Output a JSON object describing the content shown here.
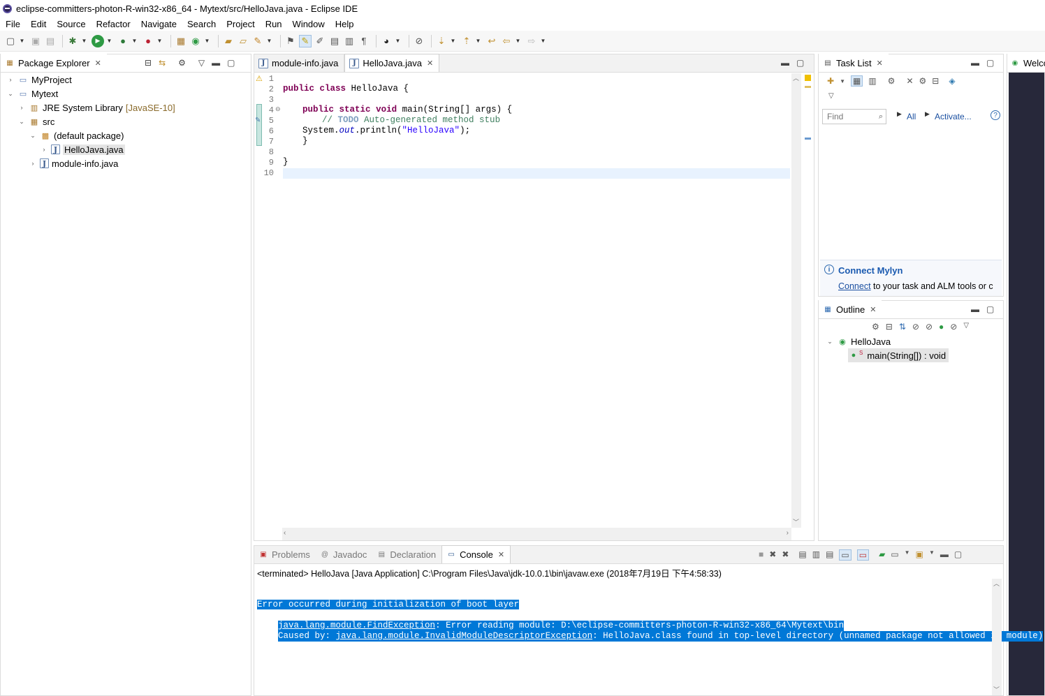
{
  "window": {
    "title": "eclipse-committers-photon-R-win32-x86_64 - Mytext/src/HelloJava.java - Eclipse IDE"
  },
  "menu": [
    "File",
    "Edit",
    "Source",
    "Refactor",
    "Navigate",
    "Search",
    "Project",
    "Run",
    "Window",
    "Help"
  ],
  "package_explorer": {
    "tab": "Package Explorer",
    "items": {
      "myproject": "MyProject",
      "mytext": "Mytext",
      "jre": "JRE System Library",
      "jre_decor": "[JavaSE-10]",
      "src": "src",
      "default_pkg": "(default package)",
      "hellojava": "HelloJava.java",
      "moduleinfo": "module-info.java"
    }
  },
  "editor": {
    "tabs": [
      "module-info.java",
      "HelloJava.java"
    ],
    "line_numbers": [
      "1",
      "2",
      "3",
      "4",
      "5",
      "6",
      "7",
      "8",
      "9",
      "10"
    ],
    "code": {
      "l2_kw1": "public",
      "l2_kw2": "class",
      "l2_rest": " HelloJava {",
      "l4_kw1": "public",
      "l4_kw2": "static",
      "l4_kw3": "void",
      "l4_rest": " main(String[] args) {",
      "l5_prefix": "// ",
      "l5_todo": "TODO",
      "l5_rest": " Auto-generated method stub",
      "l6_a": "System.",
      "l6_field": "out",
      "l6_b": ".println(",
      "l6_str": "\"HelloJava\"",
      "l6_c": ");",
      "l7": "}",
      "l9": "}"
    }
  },
  "task_list": {
    "tab": "Task List",
    "find_placeholder": "Find",
    "all_label": "All",
    "activate_label": "Activate...",
    "mylyn_title": "Connect Mylyn",
    "mylyn_link": "Connect",
    "mylyn_text": " to your task and ALM tools or c"
  },
  "outline": {
    "tab": "Outline",
    "class_name": "HelloJava",
    "method": "main(String[]) : void"
  },
  "welcome": {
    "tab": "Welco"
  },
  "console": {
    "tabs": [
      "Problems",
      "Javadoc",
      "Declaration",
      "Console"
    ],
    "header": "<terminated> HelloJava [Java Application] C:\\Program Files\\Java\\jdk-10.0.1\\bin\\javaw.exe (2018年7月19日 下午4:58:33)",
    "line1": "Error occurred during initialization of boot layer",
    "line2_a": "java.lang.module.FindException",
    "line2_b": ": Error reading module: D:\\eclipse-committers-photon-R-win32-x86_64\\Mytext\\bin",
    "line3_a": "Caused by: ",
    "line3_b": "java.lang.module.InvalidModuleDescriptorException",
    "line3_c": ": HelloJava.class found in top-level directory (unnamed package not allowed in module)"
  }
}
